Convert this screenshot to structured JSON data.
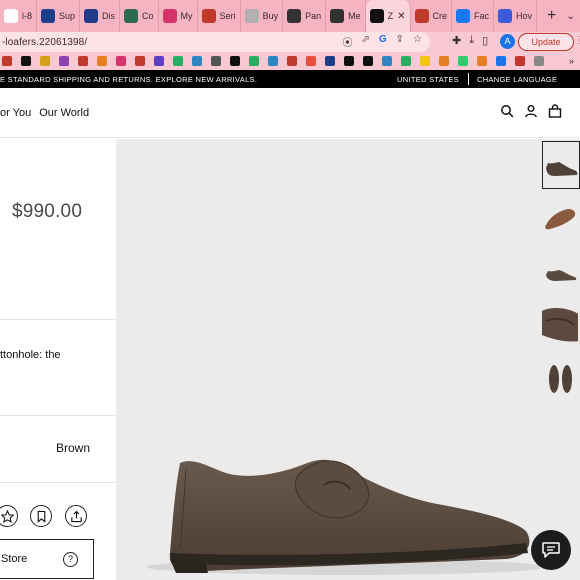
{
  "browser": {
    "tabs": [
      {
        "label": "l-8",
        "favicon_color": "#ffffff",
        "active": false
      },
      {
        "label": "Sup",
        "favicon_color": "#1f3c88",
        "active": false
      },
      {
        "label": "Dis",
        "favicon_color": "#1f3c88",
        "active": false
      },
      {
        "label": "Co",
        "favicon_color": "#2d6a4f",
        "active": false
      },
      {
        "label": "My",
        "favicon_color": "#d6336c",
        "active": false
      },
      {
        "label": "Seri",
        "favicon_color": "#c0392b",
        "active": false
      },
      {
        "label": "Buy",
        "favicon_color": "#b0b0b0",
        "active": false
      },
      {
        "label": "Pan",
        "favicon_color": "#333333",
        "active": false
      },
      {
        "label": "Me",
        "favicon_color": "#333333",
        "active": false
      },
      {
        "label": "Z",
        "favicon_color": "#111111",
        "active": true
      },
      {
        "label": "Cre",
        "favicon_color": "#c0392b",
        "active": false
      },
      {
        "label": "Fac",
        "favicon_color": "#1877f2",
        "active": false
      },
      {
        "label": "Hov",
        "favicon_color": "#3b5bdb",
        "active": false
      }
    ],
    "new_tab_label": "+",
    "url": "-loafers.22061398/",
    "profile_initial": "A",
    "update_label": "Update",
    "accent_color": "#c0392b",
    "bookmark_colors": [
      "#c0392b",
      "#111111",
      "#d4a017",
      "#8e44ad",
      "#c0392b",
      "#e67e22",
      "#d6336c",
      "#c0392b",
      "#5f3dc4",
      "#27ae60",
      "#2e86c1",
      "#555555",
      "#111111",
      "#27ae60",
      "#2e86c1",
      "#c0392b",
      "#e74c3c",
      "#1f3c88",
      "#111111",
      "#111111",
      "#2e86c1",
      "#27ae60",
      "#f1c40f",
      "#e67e22",
      "#2ecc71",
      "#e67e22",
      "#1a73e8",
      "#c0392b",
      "#888888"
    ]
  },
  "announcement": {
    "message": "E STANDARD SHIPPING AND RETURNS. EXPLORE NEW ARRIVALS.",
    "country": "UNITED STATES",
    "language_label": "CHANGE LANGUAGE"
  },
  "header": {
    "nav": [
      "or You",
      "Our World"
    ],
    "icons": [
      "search-icon",
      "account-icon",
      "bag-icon"
    ]
  },
  "product": {
    "price": "$990.00",
    "description_fragment": "ttonhole: the",
    "color": "Brown",
    "store_button_label": "Store",
    "help_label": "?",
    "actions": [
      "star-icon",
      "bookmark-icon",
      "share-icon"
    ]
  },
  "gallery": {
    "thumbnail_count": 5,
    "selected_index": 0,
    "views": [
      "side",
      "side-angled",
      "side-small",
      "top-close",
      "pair-top"
    ]
  },
  "chat": {
    "icon": "chat-icon"
  },
  "colors": {
    "suede": "#5a4a3e",
    "sole": "#2d2722",
    "stage_bg": "#ebebeb",
    "chrome_pink": "#f6b3c2"
  }
}
